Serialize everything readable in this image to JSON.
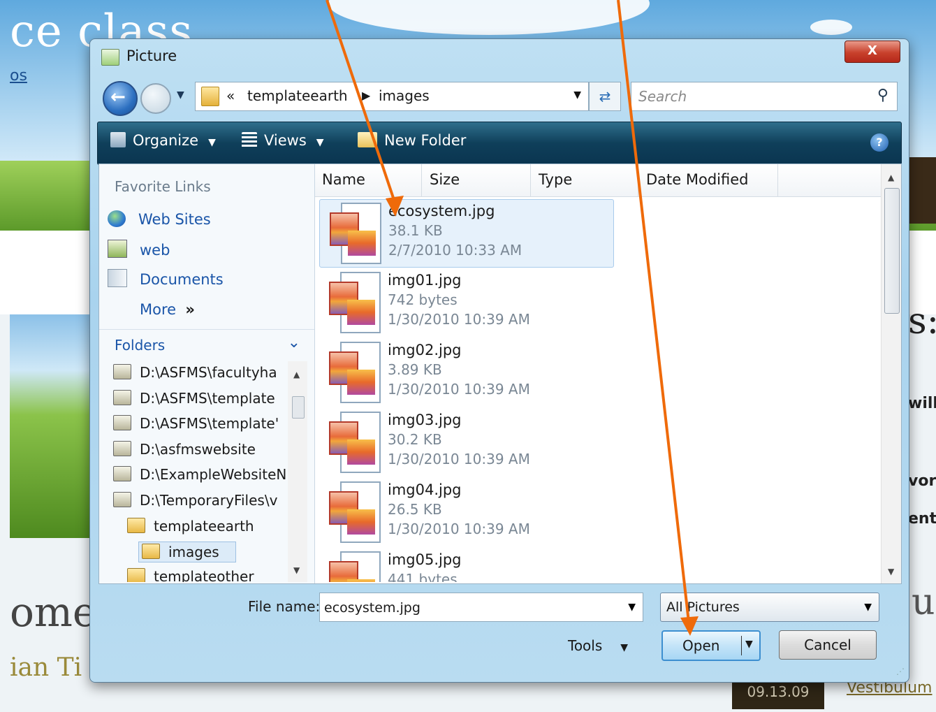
{
  "background": {
    "title": "ce class",
    "subtitle": "os",
    "heading": "ome",
    "author": "ian Ti",
    "date": "09.13.09",
    "link": "Vestibulum",
    "right_fragments": [
      "s:",
      "will",
      "vor",
      "enti",
      "ue"
    ]
  },
  "dialog": {
    "title": "Picture",
    "close_label": "X",
    "address": {
      "chevrons": "«",
      "crumbs": [
        "templateearth",
        "images"
      ]
    },
    "search_placeholder": "Search",
    "toolbar": {
      "organize": "Organize",
      "views": "Views",
      "new_folder": "New Folder",
      "help": "?"
    },
    "nav": {
      "favorites_header": "Favorite Links",
      "favorites": [
        "Web Sites",
        "web",
        "Documents"
      ],
      "more": "More",
      "more_glyph": "»",
      "folders_header": "Folders",
      "tree": [
        "D:\\ASFMS\\facultyha",
        "D:\\ASFMS\\template",
        "D:\\ASFMS\\template'",
        "D:\\asfmswebsite",
        "D:\\ExampleWebsiteN",
        "D:\\TemporaryFiles\\v",
        "templateearth",
        "images",
        "templateother"
      ]
    },
    "columns": [
      "Name",
      "Size",
      "Type",
      "Date Modified"
    ],
    "files": [
      {
        "name": "ecosystem.jpg",
        "size": "38.1 KB",
        "date": "2/7/2010 10:33 AM"
      },
      {
        "name": "img01.jpg",
        "size": "742 bytes",
        "date": "1/30/2010 10:39 AM"
      },
      {
        "name": "img02.jpg",
        "size": "3.89 KB",
        "date": "1/30/2010 10:39 AM"
      },
      {
        "name": "img03.jpg",
        "size": "30.2 KB",
        "date": "1/30/2010 10:39 AM"
      },
      {
        "name": "img04.jpg",
        "size": "26.5 KB",
        "date": "1/30/2010 10:39 AM"
      },
      {
        "name": "img05.jpg",
        "size": "441 bytes",
        "date": ""
      }
    ],
    "file_name_label": "File name:",
    "file_name_value": "ecosystem.jpg",
    "filter_value": "All Pictures",
    "tools_label": "Tools",
    "open_label": "Open",
    "cancel_label": "Cancel"
  },
  "colors": {
    "accent_arrow": "#ef6a0a",
    "link_blue": "#1a55a8",
    "toolbar_dark": "#0f3f5a"
  }
}
